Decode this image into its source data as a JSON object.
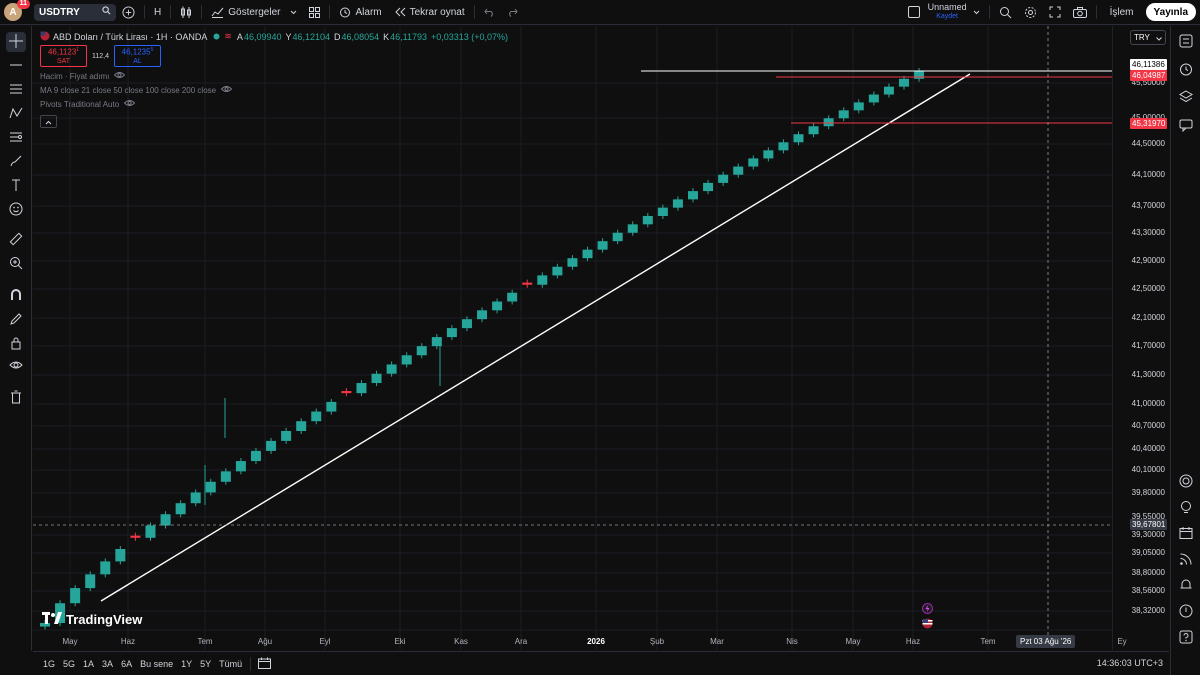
{
  "topbar": {
    "avatar_letter": "A",
    "notif_count": "11",
    "symbol": "USDTRY",
    "interval": "H",
    "indicators_label": "Göstergeler",
    "alarm_label": "Alarm",
    "replay_label": "Tekrar oynat",
    "layout_name": "Unnamed",
    "layout_status": "Kaydet",
    "trade_label": "İşlem",
    "publish_label": "Yayınla"
  },
  "legend": {
    "title": "ABD Doları / Türk Lirası · 1H · OANDA",
    "open_key": "A",
    "open": "46,09940",
    "high_key": "Y",
    "high": "46,12104",
    "low_key": "D",
    "low": "46,08054",
    "close_key": "K",
    "close": "46,11793",
    "change": "+0,03313 (+0,07%)",
    "sell_price": "46,1123",
    "sell_sup": "1",
    "sell_label": "SAT",
    "spread": "112,4",
    "buy_price": "46,1235",
    "buy_sup": "5",
    "buy_label": "AL",
    "indicators": [
      "Hacim · Fiyat adımı",
      "MA 9 close 21 close 50 close 100 close 200 close",
      "Pivots Traditional Auto"
    ]
  },
  "price_axis": {
    "currency": "TRY",
    "ticks": [
      "45,50000",
      "45,00000",
      "44,50000",
      "44,10000",
      "43,70000",
      "43,30000",
      "42,90000",
      "42,50000",
      "42,10000",
      "41,70000",
      "41,30000",
      "41,00000",
      "40,70000",
      "40,40000",
      "40,10000",
      "39,80000",
      "39,55000",
      "39,30000",
      "39,05000",
      "38,80000",
      "38,56000",
      "38,32000"
    ],
    "tag_last": "46,11386",
    "tag_red1": "46,04987",
    "tag_red2": "45,31970",
    "tag_cross": "39,67801"
  },
  "time_axis": {
    "labels": [
      "May",
      "Haz",
      "Tem",
      "Ağu",
      "Eyl",
      "Eki",
      "Kas",
      "Ara",
      "2026",
      "Şub",
      "Mar",
      "Nis",
      "May",
      "Haz",
      "Tem",
      "Ey"
    ],
    "crosshair": "Pzt 03 Ağu '26"
  },
  "chart_data": {
    "type": "candlestick",
    "symbol": "USDTRY",
    "ylim": [
      38.2,
      46.5
    ],
    "x": [
      "May",
      "Haz",
      "Tem",
      "Ağu",
      "Eyl",
      "Eki",
      "Kas",
      "Ara",
      "2026",
      "Şub",
      "Mar",
      "Nis",
      "May",
      "Haz"
    ],
    "close_first": 38.35,
    "close_last": 46.11,
    "horizontal_lines": [
      46.11386,
      46.04987,
      45.3197
    ],
    "trendline": [
      [
        38.75,
        "May"
      ],
      [
        46.08,
        "Haz"
      ]
    ],
    "crosshair_price": 39.67801,
    "colors": {
      "up": "#26a69a",
      "down": "#f23645"
    }
  },
  "bottombar": {
    "ranges": [
      "1G",
      "5G",
      "1A",
      "3A",
      "6A",
      "Bu sene",
      "1Y",
      "5Y",
      "Tümü"
    ],
    "clock": "14:36:03 UTC+3"
  },
  "logo": "TradingView"
}
